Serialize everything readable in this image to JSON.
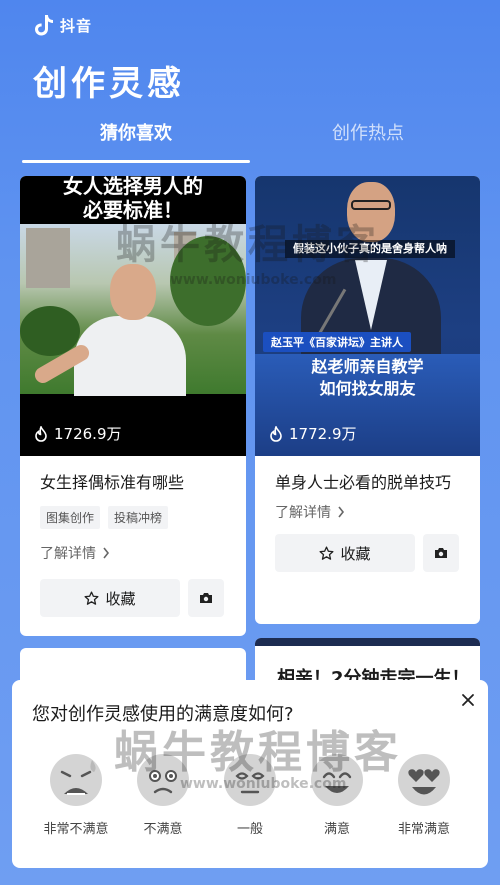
{
  "app": {
    "name": "抖音",
    "icon": "douyin-logo"
  },
  "page_title": "创作灵感",
  "tabs": [
    {
      "label": "猜你喜欢",
      "active": true
    },
    {
      "label": "创作热点",
      "active": false
    }
  ],
  "cards": [
    {
      "thumb_caption_line1": "女人选择男人的",
      "thumb_caption_line2": "必要标准！",
      "play_count": "1726.9万",
      "title": "女生择偶标准有哪些",
      "tags": [
        "图集创作",
        "投稿冲榜"
      ],
      "detail_label": "了解详情",
      "fav_label": "收藏"
    },
    {
      "thumb_speech": "假装这小伙子真的是舍身帮人呐",
      "thumb_name_tag": "赵玉平《百家讲坛》主讲人",
      "thumb_headline_line1": "赵老师亲自教学",
      "thumb_headline_line2": "如何找女朋友",
      "play_count": "1772.9万",
      "title": "单身人士必看的脱单技巧",
      "detail_label": "了解详情",
      "fav_label": "收藏"
    }
  ],
  "peek_card": {
    "text": "相亲！2分钟走完一生！"
  },
  "survey": {
    "question": "您对创作灵感使用的满意度如何?",
    "options": [
      {
        "label": "非常不满意",
        "icon": "very-unsatisfied-face-icon"
      },
      {
        "label": "不满意",
        "icon": "unsatisfied-face-icon"
      },
      {
        "label": "一般",
        "icon": "neutral-face-icon"
      },
      {
        "label": "满意",
        "icon": "satisfied-face-icon"
      },
      {
        "label": "非常满意",
        "icon": "very-satisfied-face-icon"
      }
    ]
  },
  "watermark": {
    "text": "蜗牛教程博客",
    "url": "www.woniuboke.com"
  },
  "colors": {
    "background": "#5f93f0",
    "card": "#ffffff",
    "button_bg": "#f2f3f5"
  }
}
